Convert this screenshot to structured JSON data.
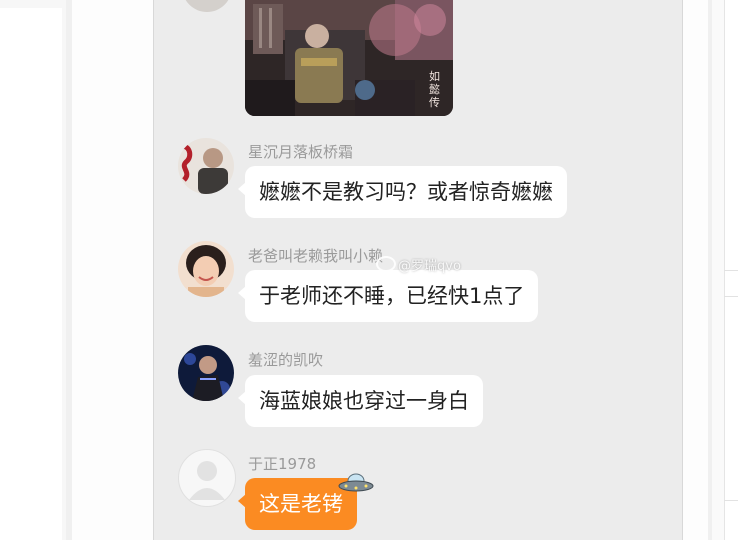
{
  "messages": [
    {
      "username": "星沉月落板桥霜",
      "text": "嬷嬷不是教习吗？或者惊奇嬷嬷"
    },
    {
      "username": "老爸叫老赖我叫小赖",
      "text": "于老师还不睡，已经快1点了"
    },
    {
      "username": "羞涩的凯吹",
      "text": "海蓝娘娘也穿过一身白"
    },
    {
      "username": "于正1978",
      "text": "这是老铐"
    }
  ],
  "watermark": "@罗瑞qvo",
  "photo_caption": "如懿传",
  "colors": {
    "chat_background": "#ececec",
    "bubble_white": "#ffffff",
    "bubble_orange": "#fb8b22",
    "username_gray": "#9a9a9a"
  },
  "icons": [
    "ufo-sticker-icon",
    "weibo-logo-icon",
    "default-avatar-icon"
  ]
}
